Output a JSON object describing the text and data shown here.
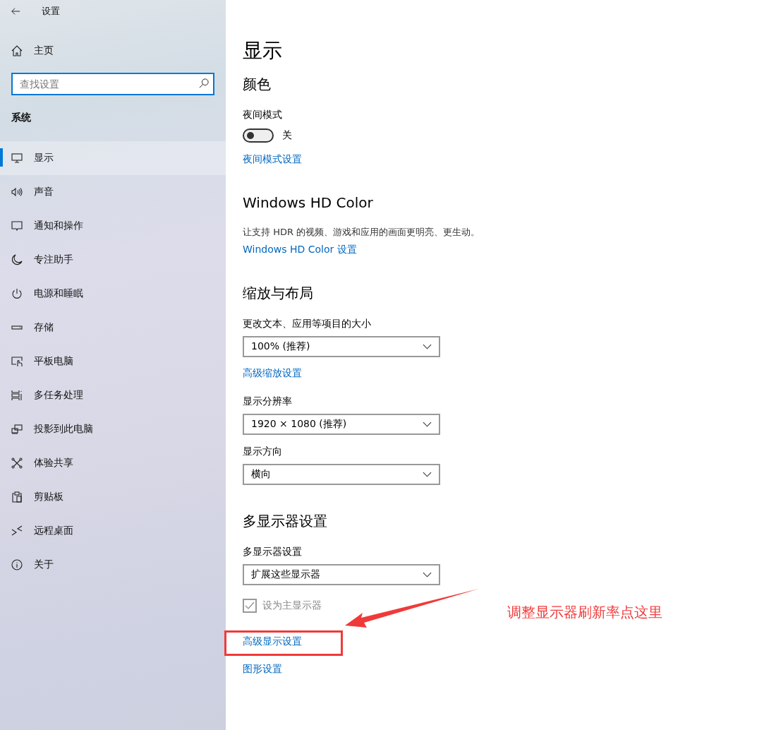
{
  "sidebar": {
    "title": "设置",
    "home": "主页",
    "search_placeholder": "查找设置",
    "section": "系统",
    "items": [
      {
        "label": "显示",
        "selected": true
      },
      {
        "label": "声音",
        "selected": false
      },
      {
        "label": "通知和操作",
        "selected": false
      },
      {
        "label": "专注助手",
        "selected": false
      },
      {
        "label": "电源和睡眠",
        "selected": false
      },
      {
        "label": "存储",
        "selected": false
      },
      {
        "label": "平板电脑",
        "selected": false
      },
      {
        "label": "多任务处理",
        "selected": false
      },
      {
        "label": "投影到此电脑",
        "selected": false
      },
      {
        "label": "体验共享",
        "selected": false
      },
      {
        "label": "剪贴板",
        "selected": false
      },
      {
        "label": "远程桌面",
        "selected": false
      },
      {
        "label": "关于",
        "selected": false
      }
    ]
  },
  "page": {
    "title": "显示",
    "sections": [
      {
        "heading": "颜色",
        "rows": [
          {
            "kind": "label",
            "text": "夜间模式"
          },
          {
            "kind": "toggle",
            "on": false,
            "text": "关"
          },
          {
            "kind": "link",
            "text": "夜间模式设置"
          }
        ]
      },
      {
        "heading": "Windows HD Color",
        "rows": [
          {
            "kind": "desc",
            "text": "让支持 HDR 的视频、游戏和应用的画面更明亮、更生动。"
          },
          {
            "kind": "link",
            "text": "Windows HD Color 设置"
          }
        ]
      },
      {
        "heading": "缩放与布局",
        "rows": [
          {
            "kind": "label",
            "text": "更改文本、应用等项目的大小"
          },
          {
            "kind": "dropdown",
            "text": "100% (推荐)"
          },
          {
            "kind": "link",
            "text": "高级缩放设置"
          },
          {
            "kind": "label",
            "text": "显示分辨率"
          },
          {
            "kind": "dropdown",
            "text": "1920 × 1080 (推荐)"
          },
          {
            "kind": "label",
            "text": "显示方向"
          },
          {
            "kind": "dropdown",
            "text": "横向"
          }
        ]
      },
      {
        "heading": "多显示器设置",
        "rows": [
          {
            "kind": "label",
            "text": "多显示器设置"
          },
          {
            "kind": "dropdown",
            "text": "扩展这些显示器"
          },
          {
            "kind": "checkbox",
            "checked": true,
            "disabled": true,
            "text": "设为主显示器"
          },
          {
            "kind": "link",
            "text": "高级显示设置"
          },
          {
            "kind": "link",
            "text": "图形设置"
          }
        ]
      }
    ]
  },
  "annotation": {
    "text": "调整显示器刷新率点这里"
  }
}
